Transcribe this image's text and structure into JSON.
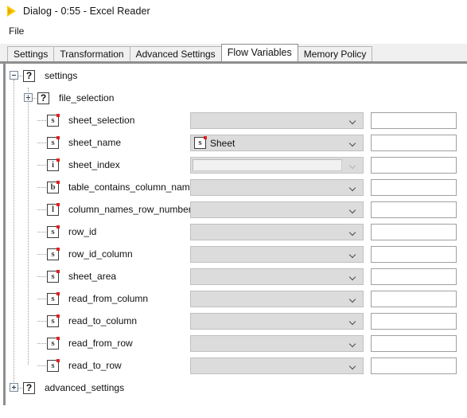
{
  "window": {
    "title": "Dialog - 0:55 - Excel Reader",
    "icon": "warning-triangle-icon"
  },
  "menubar": {
    "items": [
      {
        "label": "File"
      }
    ]
  },
  "tabs": [
    {
      "label": "Settings",
      "active": false
    },
    {
      "label": "Transformation",
      "active": false
    },
    {
      "label": "Advanced Settings",
      "active": false
    },
    {
      "label": "Flow Variables",
      "active": true
    },
    {
      "label": "Memory Policy",
      "active": false
    }
  ],
  "tree": {
    "rows": [
      {
        "name": "settings",
        "icon": "question-mark-icon",
        "icon_glyph": "?",
        "depth": 0,
        "handle": "minus",
        "has_controls": false
      },
      {
        "name": "file_selection",
        "icon": "question-mark-icon",
        "icon_glyph": "?",
        "depth": 1,
        "handle": "plus",
        "has_controls": false
      },
      {
        "name": "sheet_selection",
        "icon": "string-variable-icon",
        "icon_glyph": "s",
        "depth": 2,
        "handle": "none",
        "has_controls": true,
        "combo_value": "",
        "combo_state": "enabled",
        "textfield_value": ""
      },
      {
        "name": "sheet_name",
        "icon": "string-variable-icon",
        "icon_glyph": "s",
        "depth": 2,
        "handle": "none",
        "has_controls": true,
        "combo_value": "Sheet",
        "combo_value_icon": "string-variable-icon",
        "combo_value_icon_glyph": "s",
        "combo_state": "enabled",
        "textfield_value": ""
      },
      {
        "name": "sheet_index",
        "icon": "integer-variable-icon",
        "icon_glyph": "i",
        "depth": 2,
        "handle": "none",
        "has_controls": true,
        "combo_value": "",
        "combo_state": "disabled",
        "textfield_value": ""
      },
      {
        "name": "table_contains_column_names",
        "icon": "boolean-variable-icon",
        "icon_glyph": "b",
        "depth": 2,
        "handle": "none",
        "has_controls": true,
        "combo_value": "",
        "combo_state": "enabled",
        "textfield_value": ""
      },
      {
        "name": "column_names_row_number",
        "icon": "long-variable-icon",
        "icon_glyph": "l",
        "depth": 2,
        "handle": "none",
        "has_controls": true,
        "combo_value": "",
        "combo_state": "enabled",
        "textfield_value": ""
      },
      {
        "name": "row_id",
        "icon": "string-variable-icon",
        "icon_glyph": "s",
        "depth": 2,
        "handle": "none",
        "has_controls": true,
        "combo_value": "",
        "combo_state": "enabled",
        "textfield_value": ""
      },
      {
        "name": "row_id_column",
        "icon": "string-variable-icon",
        "icon_glyph": "s",
        "depth": 2,
        "handle": "none",
        "has_controls": true,
        "combo_value": "",
        "combo_state": "enabled",
        "textfield_value": ""
      },
      {
        "name": "sheet_area",
        "icon": "string-variable-icon",
        "icon_glyph": "s",
        "depth": 2,
        "handle": "none",
        "has_controls": true,
        "combo_value": "",
        "combo_state": "enabled",
        "textfield_value": ""
      },
      {
        "name": "read_from_column",
        "icon": "string-variable-icon",
        "icon_glyph": "s",
        "depth": 2,
        "handle": "none",
        "has_controls": true,
        "combo_value": "",
        "combo_state": "enabled",
        "textfield_value": ""
      },
      {
        "name": "read_to_column",
        "icon": "string-variable-icon",
        "icon_glyph": "s",
        "depth": 2,
        "handle": "none",
        "has_controls": true,
        "combo_value": "",
        "combo_state": "enabled",
        "textfield_value": ""
      },
      {
        "name": "read_from_row",
        "icon": "string-variable-icon",
        "icon_glyph": "s",
        "depth": 2,
        "handle": "none",
        "has_controls": true,
        "combo_value": "",
        "combo_state": "enabled",
        "textfield_value": ""
      },
      {
        "name": "read_to_row",
        "icon": "string-variable-icon",
        "icon_glyph": "s",
        "depth": 2,
        "handle": "none",
        "has_controls": true,
        "combo_value": "",
        "combo_state": "enabled",
        "textfield_value": ""
      },
      {
        "name": "advanced_settings",
        "icon": "question-mark-icon",
        "icon_glyph": "?",
        "depth": 0,
        "handle": "plus",
        "has_controls": false
      }
    ]
  },
  "colors": {
    "accent_yellow": "#ffcc00",
    "variable_dot_red": "#e02020",
    "panel_border": "#8e8e8e",
    "combo_fill": "#dcdcdc",
    "tabstrip_bg": "#f0f0f0"
  }
}
